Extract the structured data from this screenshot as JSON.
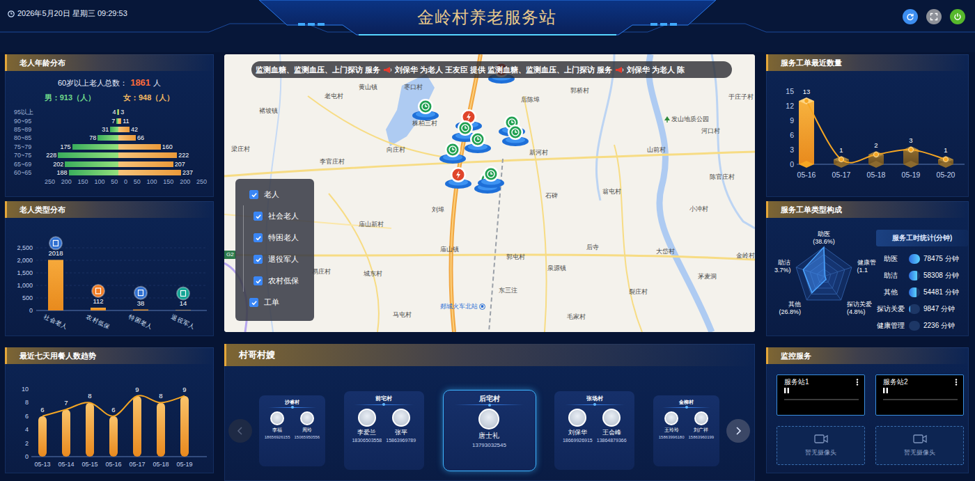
{
  "header": {
    "datetime": "2026年5月20日 星期三 09:29:53",
    "title": "金岭村养老服务站",
    "buttons": [
      {
        "kind": "refresh",
        "color": "#3d8ef0"
      },
      {
        "kind": "fullscreen",
        "color": "#8d9098"
      },
      {
        "kind": "power",
        "color": "#56b82c"
      }
    ]
  },
  "age_panel": {
    "title": "老人年龄分布",
    "total_label": "60岁以上老人总数：",
    "total": "1861",
    "total_unit": "人",
    "male": "男：913（人）",
    "female": "女：948（人）",
    "rows": [
      {
        "label": "95以上",
        "male": 4,
        "female": 3,
        "male_text": "4",
        "female_text": "3"
      },
      {
        "label": "90~95",
        "male": 7,
        "female": 11,
        "male_text": "7",
        "female_text": "11"
      },
      {
        "label": "85~89",
        "male": 31,
        "female": 42,
        "male_text": "31",
        "female_text": "42"
      },
      {
        "label": "80~85",
        "male": 78,
        "female": 66,
        "male_text": "78",
        "female_text": "66"
      },
      {
        "label": "75~79",
        "male": 175,
        "female": 160,
        "male_text": "175",
        "female_text": "160"
      },
      {
        "label": "70~75",
        "male": 228,
        "female": 222,
        "male_text": "228",
        "female_text": "222"
      },
      {
        "label": "65~69",
        "male": 202,
        "female": 207,
        "male_text": "202",
        "female_text": "207"
      },
      {
        "label": "60~65",
        "male": 188,
        "female": 237,
        "male_text": "188",
        "female_text": "237"
      }
    ],
    "ticks": [
      "250",
      "200",
      "150",
      "100",
      "50",
      "0",
      "50",
      "100",
      "150",
      "200",
      "250"
    ]
  },
  "type_panel": {
    "title": "老人类型分布",
    "ticks": [
      "2,500",
      "2,000",
      "1,500",
      "1,000",
      "500",
      "0"
    ],
    "bars": [
      {
        "label": "社会老人",
        "value": 2018,
        "text": "2018",
        "color": "#2f6fd0"
      },
      {
        "label": "农村低保",
        "value": 112,
        "text": "112",
        "color": "#f07a22"
      },
      {
        "label": "特困老人",
        "value": 38,
        "text": "38",
        "color": "#2f6fd0"
      },
      {
        "label": "退役军人",
        "value": 14,
        "text": "14",
        "color": "#13a394"
      }
    ]
  },
  "trend_panel": {
    "title": "最近七天用餐人数趋势",
    "ticks": [
      "10",
      "8",
      "6",
      "4",
      "2",
      "0"
    ],
    "dates": [
      "05-13",
      "05-14",
      "05-15",
      "05-16",
      "05-17",
      "05-18",
      "05-19"
    ],
    "values": [
      6,
      7,
      8,
      6,
      9,
      8,
      9
    ],
    "value_texts": [
      "6",
      "7",
      "8",
      "6",
      "9",
      "8",
      "9"
    ]
  },
  "map": {
    "ticker": [
      "监测血糖、监测血压、上门探访 服务",
      "刘保华 为老人 王友臣 提供 监测血糖、监测血压、上门探访 服务",
      "刘保华 为老人 陈"
    ],
    "places": [
      "黄山镇",
      "枣口村",
      "老屯村",
      "郭桥村",
      "褚坡镇",
      "后陈埠",
      "于庄子村",
      "株柏三村",
      "发山地质公园",
      "河口村",
      "梁庄村",
      "向庄村",
      "李官庄村",
      "新河村",
      "山前村",
      "陈官庄村",
      "石碑",
      "翁屯村",
      "小冲村",
      "刘埠",
      "庙山新村",
      "庙山镇",
      "后寺",
      "大岱村",
      "郭屯村",
      "金岭村",
      "城东村",
      "泉源镇",
      "易庄村",
      "东三注",
      "裂庄村",
      "茅麦洞",
      "马屯村",
      "毛家村"
    ],
    "station": "郯城火车北站",
    "road_badge": "G2",
    "pins": [
      {
        "kind": "order"
      },
      {
        "kind": "service"
      },
      {
        "kind": "order"
      },
      {
        "kind": "service"
      },
      {
        "kind": "service"
      },
      {
        "kind": "service"
      },
      {
        "kind": "service"
      },
      {
        "kind": "service"
      },
      {
        "kind": "order"
      },
      {
        "kind": "service"
      },
      {
        "kind": "service"
      }
    ],
    "layers": [
      {
        "label": "老人",
        "checked": true,
        "child": false
      },
      {
        "label": "社会老人",
        "checked": true,
        "child": true
      },
      {
        "label": "特困老人",
        "checked": true,
        "child": true
      },
      {
        "label": "退役军人",
        "checked": true,
        "child": true
      },
      {
        "label": "农村低保",
        "checked": true,
        "child": true
      },
      {
        "label": "工单",
        "checked": true,
        "child": false
      }
    ]
  },
  "village_panel": {
    "title": "村哥村嫂",
    "prev_enabled": false,
    "next_enabled": true,
    "cards": [
      {
        "village": "沙睿村",
        "selected": false,
        "people": [
          {
            "name": "李福",
            "phone": "18656926155"
          },
          {
            "name": "周玲",
            "phone": "15065950556"
          }
        ]
      },
      {
        "village": "前宅村",
        "selected": false,
        "people": [
          {
            "name": "李爱兰",
            "phone": "18306503558"
          },
          {
            "name": "张平",
            "phone": "15863969789"
          }
        ]
      },
      {
        "village": "后宅村",
        "selected": true,
        "people": [
          {
            "name": "唐士礼",
            "phone": "13793032545"
          }
        ]
      },
      {
        "village": "张场村",
        "selected": false,
        "people": [
          {
            "name": "刘保华",
            "phone": "18669926915"
          },
          {
            "name": "王会峰",
            "phone": "13864879366"
          }
        ]
      },
      {
        "village": "金柳村",
        "selected": false,
        "people": [
          {
            "name": "王玲玲",
            "phone": "15863996180"
          },
          {
            "name": "刘广祥",
            "phone": "15863960199"
          }
        ]
      }
    ]
  },
  "orders_panel": {
    "title": "服务工单最近数量",
    "ticks": [
      "15",
      "12",
      "9",
      "6",
      "3",
      "0"
    ],
    "bars": [
      {
        "date": "05-16",
        "value": 13,
        "text": "13",
        "selected": true
      },
      {
        "date": "05-17",
        "value": 1,
        "text": "1",
        "selected": false
      },
      {
        "date": "05-18",
        "value": 2,
        "text": "2",
        "selected": false
      },
      {
        "date": "05-19",
        "value": 3,
        "text": "3",
        "selected": false
      },
      {
        "date": "05-20",
        "value": 1,
        "text": "1",
        "selected": false
      }
    ]
  },
  "composition_panel": {
    "title": "服务工单类型构成",
    "radar": [
      {
        "name": "助医",
        "pct": "(38.6%)",
        "value": 78475
      },
      {
        "name": "健康管",
        "pct": "(1.1",
        "value": 2236
      },
      {
        "name": "探访关爱",
        "pct": "(4.8%)",
        "value": 9847
      },
      {
        "name": "其他",
        "pct": "(26.8%)",
        "value": 54481
      },
      {
        "name": "助洁",
        "pct": "3.7%)",
        "value": 58308
      }
    ],
    "hours_title": "服务工时统计(分钟)",
    "hours": [
      {
        "name": "助医",
        "text": "78475 分钟",
        "level": 1
      },
      {
        "name": "助洁",
        "text": "58308 分钟",
        "level": 0.74
      },
      {
        "name": "其他",
        "text": "54481 分钟",
        "level": 0.69
      },
      {
        "name": "探访关爱",
        "text": "9847 分钟",
        "level": 0.13
      },
      {
        "name": "健康管理",
        "text": "2236 分钟",
        "level": 0.03
      }
    ]
  },
  "monitor_panel": {
    "title": "监控服务",
    "cameras": [
      {
        "kind": "video",
        "label": "服务站1"
      },
      {
        "kind": "video",
        "label": "服务站2"
      },
      {
        "kind": "empty",
        "label": "暂无摄像头"
      },
      {
        "kind": "empty",
        "label": "暂无摄像头"
      }
    ]
  }
}
